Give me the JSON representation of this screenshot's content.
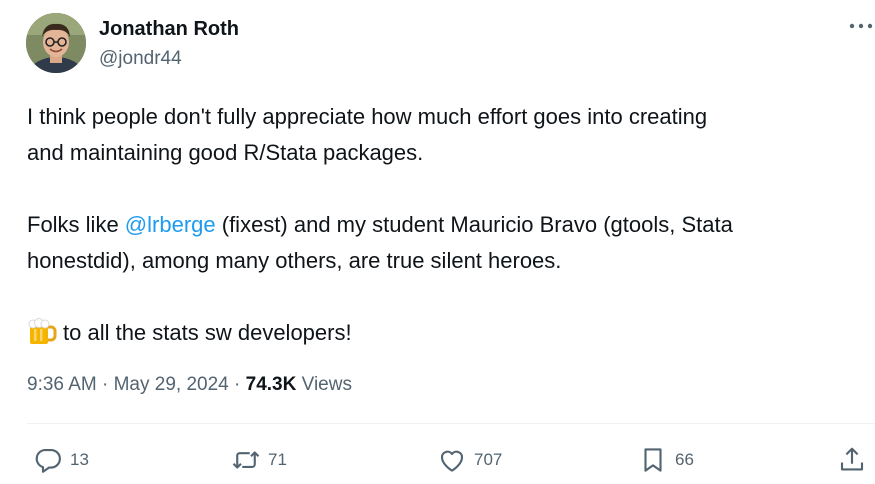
{
  "author": {
    "name": "Jonathan Roth",
    "handle": "@jondr44"
  },
  "tweet": {
    "line1": "I think people don't fully appreciate how much effort goes into creating",
    "line2": "and maintaining good R/Stata packages.",
    "p2_prefix": "Folks like ",
    "mention": "@lrberge",
    "p2_line1_suffix": " (fixest) and my student Mauricio Bravo (gtools, Stata",
    "p2_line2": "honestdid), among many others, are true silent heroes.",
    "p3_text": "to all the stats sw developers!"
  },
  "meta": {
    "time": "9:36 AM",
    "separator": "·",
    "date": "May 29, 2024",
    "views_count": "74.3K",
    "views_label": "Views"
  },
  "actions": {
    "replies": "13",
    "reposts": "71",
    "likes": "707",
    "bookmarks": "66"
  },
  "icons": [
    "more-icon",
    "reply-icon",
    "repost-icon",
    "like-icon",
    "bookmark-icon",
    "share-icon",
    "beer-emoji-icon"
  ],
  "colors": {
    "text": "#0f1419",
    "secondary": "#536471",
    "accent": "#1d9bf0",
    "divider": "#eff3f4"
  }
}
